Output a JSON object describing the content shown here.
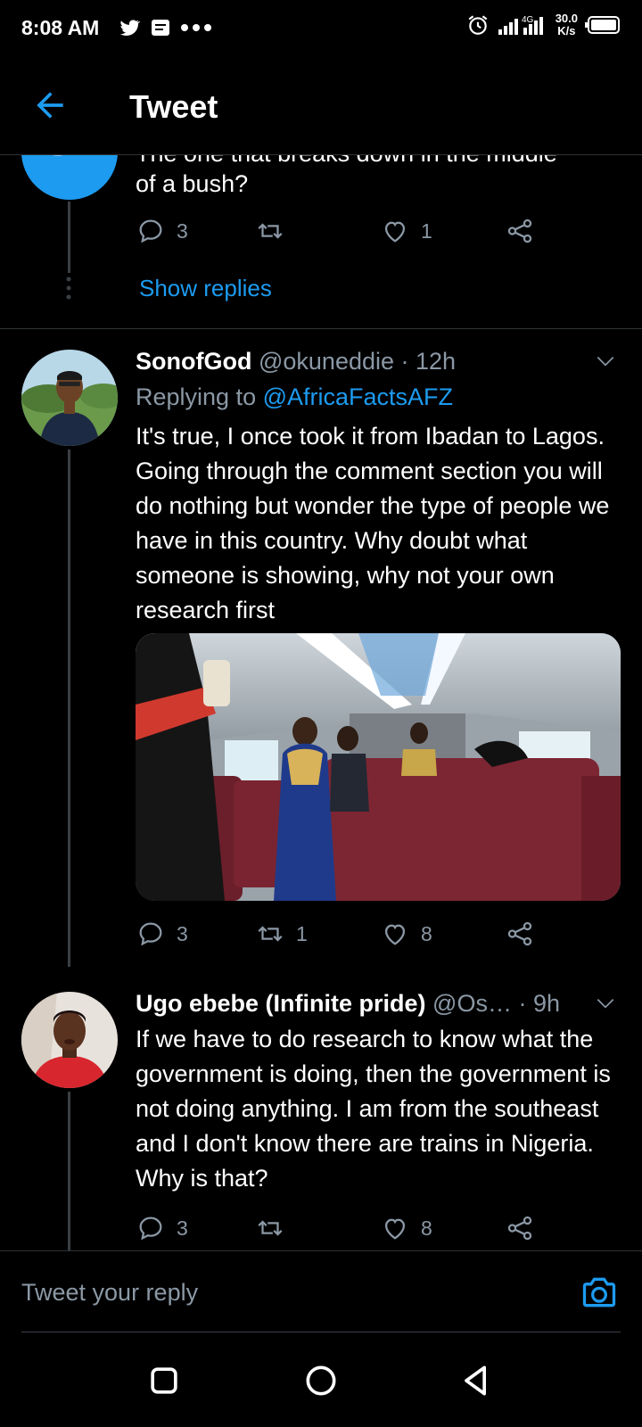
{
  "status_bar": {
    "time": "8:08 AM",
    "netspeed_value": "30.0",
    "netspeed_unit": "K/s",
    "network_type": "4G",
    "icons": [
      "twitter-notification-icon",
      "message-icon",
      "more-dots-icon",
      "alarm-icon",
      "signal-icon",
      "battery-icon"
    ]
  },
  "header": {
    "title": "Tweet"
  },
  "first_tweet": {
    "text_partial": "The one that breaks down in the middle",
    "text": "of a bush?",
    "replies": "3",
    "retweets": "",
    "likes": "1",
    "show_replies": "Show replies"
  },
  "tweets": [
    {
      "name": "SonofGod",
      "handle": "@okuneddie",
      "time": "· 12h",
      "replying_prefix": "Replying to ",
      "replying_to": "@AfricaFactsAFZ",
      "text": "It's true, I once took it from Ibadan to Lagos. Going through the comment section you will do nothing but wonder the type of people we have in this country. Why doubt what someone is showing, why not your own research first",
      "replies": "3",
      "retweets": "1",
      "likes": "8"
    },
    {
      "name": "Ugo ebebe (Infinite pride)",
      "handle": "@Os…",
      "time": "· 9h",
      "text": "If we have to do research to know what the government is doing,  then the government is not doing anything.   I am from the southeast and I don't know there are trains in Nigeria.  Why is that?",
      "replies": "3",
      "retweets": "",
      "likes": "8"
    }
  ],
  "composer": {
    "placeholder": "Tweet your reply"
  },
  "colors": {
    "accent": "#1d9bf0",
    "muted": "#8b98a5",
    "background": "#000000",
    "divider": "#2f3336"
  }
}
